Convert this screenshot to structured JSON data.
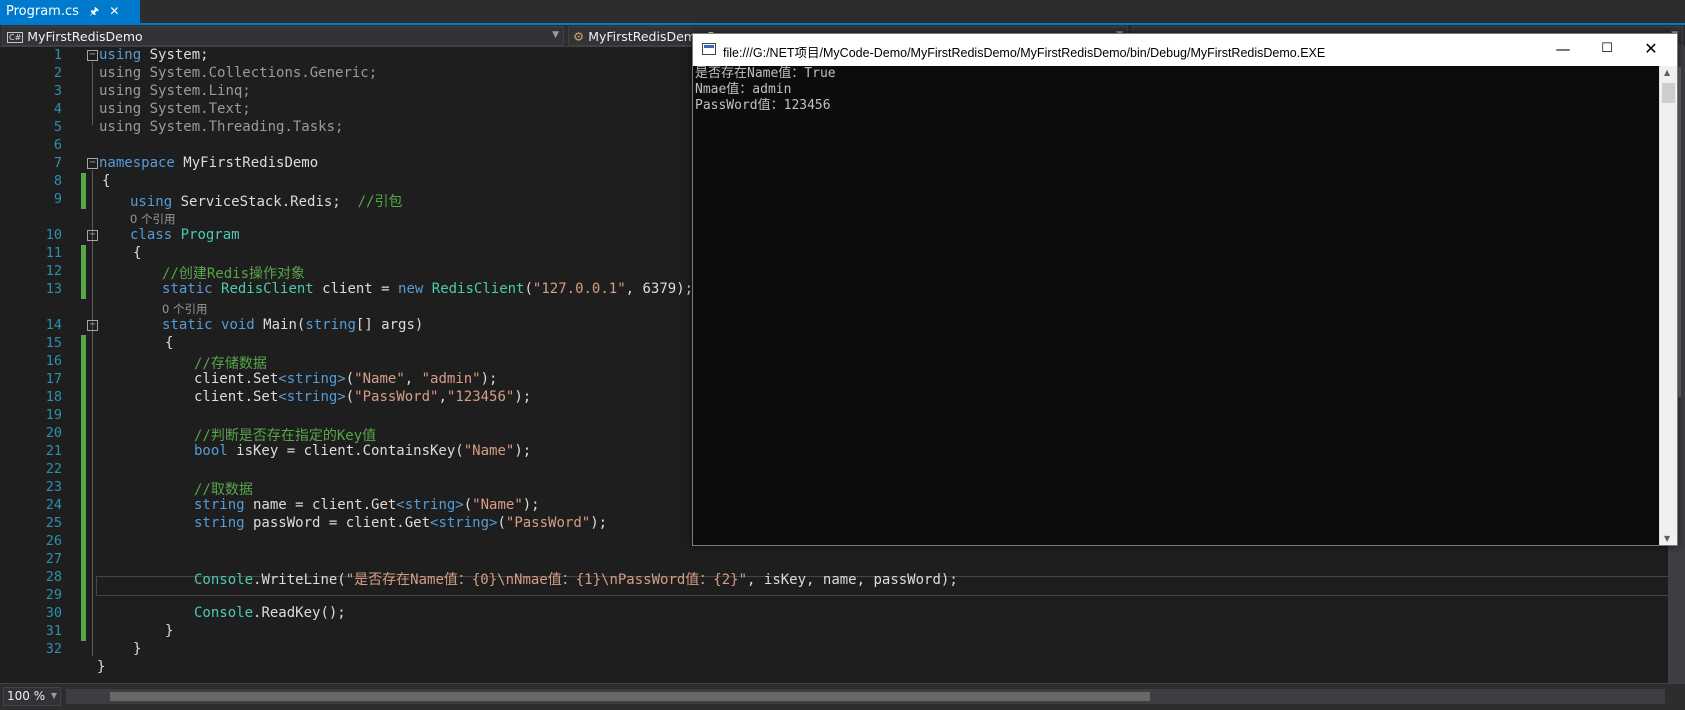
{
  "tab": {
    "label": "Program.cs",
    "pin_icon": "pin-icon",
    "close_icon": "close-icon"
  },
  "navbar": {
    "project": "MyFirstRedisDemo",
    "project_icon_text": "C#",
    "class": "MyFirstRedisDemo.Program"
  },
  "editor": {
    "line_numbers": [
      "1",
      "2",
      "3",
      "4",
      "5",
      "6",
      "7",
      "8",
      "9",
      "10",
      "11",
      "12",
      "13",
      "14",
      "15",
      "16",
      "17",
      "18",
      "19",
      "20",
      "21",
      "22",
      "23",
      "24",
      "25",
      "26",
      "27",
      "28",
      "29",
      "30",
      "31",
      "32"
    ],
    "reference_hint": "0 个引用",
    "tokens": {
      "using": "using",
      "System": "System;",
      "Collections": "System.Collections.Generic;",
      "Linq": "System.Linq;",
      "Text": "System.Text;",
      "Threading": "System.Threading.Tasks;",
      "namespace": "namespace",
      "namespace_name": "MyFirstRedisDemo",
      "open_brace": "{",
      "close_brace": "}",
      "redis_ns": "ServiceStack.Redis;",
      "comment_import": "//引包",
      "class_kw": "class",
      "class_name": "Program",
      "comment_create": "//创建Redis操作对象",
      "static_kw": "static",
      "RedisClient": "RedisClient",
      "client_decl": " client = ",
      "new_kw": "new",
      "ctor_args_open": "(",
      "host_str": "\"127.0.0.1\"",
      "port_tail": ", 6379);",
      "void_kw": "void",
      "main_sig": " Main(",
      "string_kw": "string",
      "args_tail": "[] args)",
      "comment_store": "//存储数据",
      "client_set": "client.Set",
      "generic_string": "<string>",
      "set1_args_open": "(",
      "name_str": "\"Name\"",
      "comma_sp": ", ",
      "admin_str": "\"admin\"",
      "close_paren_semi": ");",
      "password_str": "\"PassWord\"",
      "comma": ",",
      "pwd_value_str": "\"123456\"",
      "comment_check": "//判断是否存在指定的Key值",
      "bool_kw": "bool",
      "iskey_decl": " isKey = client.ContainsKey(",
      "comment_get": "//取数据",
      "name_decl": " name = client.Get",
      "paren_open": "(",
      "password_decl": " passWord = client.Get",
      "Console": "Console",
      "writeline": ".WriteLine(",
      "format_str": "\"是否存在Name值：{0}\\nNmae值：{1}\\nPassWord值：{2}\"",
      "writeline_tail": ", isKey, name, passWord);",
      "readkey": ".ReadKey();"
    }
  },
  "console_window": {
    "title": "file:///G:/NET项目/MyCode-Demo/MyFirstRedisDemo/MyFirstRedisDemo/bin/Debug/MyFirstRedisDemo.EXE",
    "lines": [
      "是否存在Name值：True",
      "Nmae值：admin",
      "PassWord值：123456"
    ],
    "minimize": "—",
    "maximize": "☐",
    "close": "✕"
  },
  "status": {
    "zoom": "100 %"
  },
  "colors": {
    "accent": "#007acc",
    "keyword": "#569cd6",
    "type": "#4ec9b0",
    "string": "#d69d85",
    "comment": "#57a64a",
    "line_number": "#2b91af"
  }
}
